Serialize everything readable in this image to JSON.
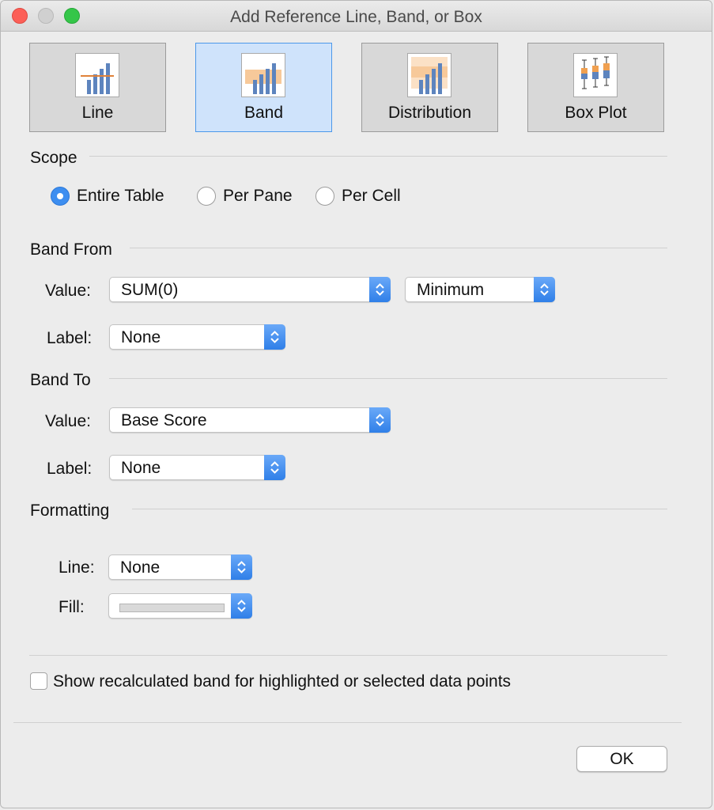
{
  "window": {
    "title": "Add Reference Line, Band, or Box"
  },
  "types": [
    {
      "label": "Line",
      "icon": "line-chart-icon"
    },
    {
      "label": "Band",
      "icon": "band-chart-icon",
      "selected": true
    },
    {
      "label": "Distribution",
      "icon": "distribution-chart-icon"
    },
    {
      "label": "Box Plot",
      "icon": "box-plot-icon"
    }
  ],
  "scope": {
    "heading": "Scope",
    "options": [
      {
        "label": "Entire Table",
        "checked": true
      },
      {
        "label": "Per Pane",
        "checked": false
      },
      {
        "label": "Per Cell",
        "checked": false
      }
    ]
  },
  "band_from": {
    "heading": "Band From",
    "value_label": "Value:",
    "value": "SUM(0)",
    "aggregation": "Minimum",
    "label_label": "Label:",
    "label_value": "None"
  },
  "band_to": {
    "heading": "Band To",
    "value_label": "Value:",
    "value": "Base Score",
    "label_label": "Label:",
    "label_value": "None"
  },
  "formatting": {
    "heading": "Formatting",
    "line_label": "Line:",
    "line_value": "None",
    "fill_label": "Fill:",
    "fill_color": "#d9d9d9"
  },
  "options": {
    "recalc_label": "Show recalculated band for highlighted or selected data points",
    "recalc_checked": false
  },
  "footer": {
    "ok_label": "OK"
  },
  "colors": {
    "accent": "#3d8ef0",
    "selected_bg": "#cfe3fb",
    "bar": "#5d84be",
    "band": "#f7c99a",
    "ref_line": "#e0823a"
  }
}
